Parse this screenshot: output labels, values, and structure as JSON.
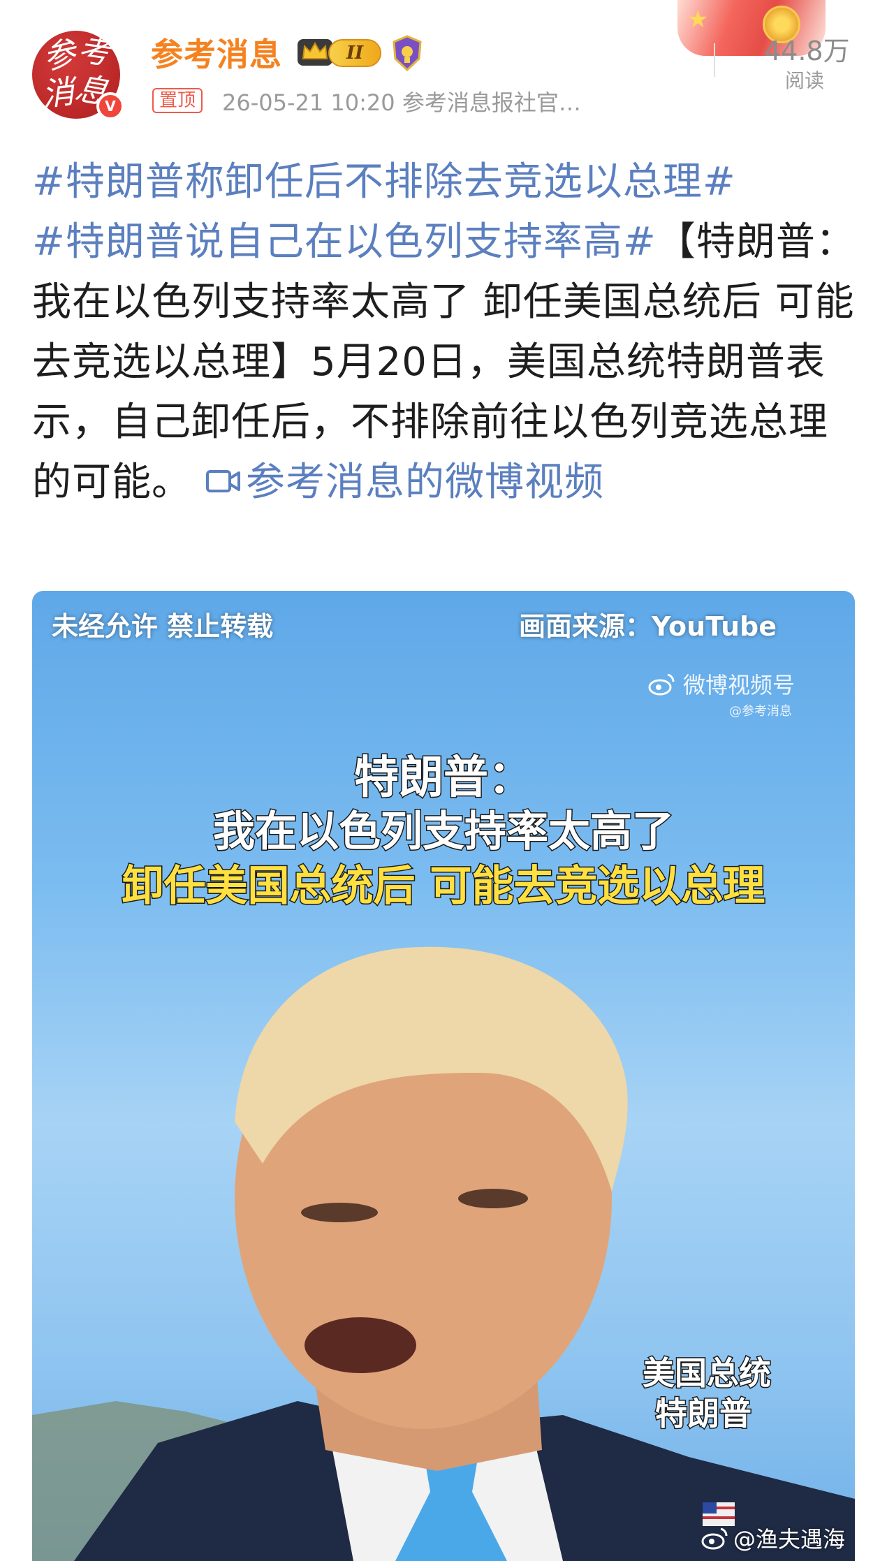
{
  "account": {
    "avatar_glyphs": [
      "参",
      "考",
      "消",
      "息"
    ],
    "verified_mark": "V",
    "name": "参考消息",
    "level_badge": "II",
    "colors": {
      "name": "#f5821f",
      "tag": "#5b7fbf",
      "pinned": "#f05a4a"
    }
  },
  "post_meta": {
    "pinned_label": "置顶",
    "info": "26-05-21 10:20  参考消息报社官…",
    "reads_count": "44.8万",
    "reads_label": "阅读"
  },
  "post": {
    "tag1": "#特朗普称卸任后不排除去竞选以总理#",
    "tag2": "#特朗普说自己在以色列支持率高#",
    "body": "【特朗普：我在以色列支持率太高了 卸任美国总统后 可能去竞选以总理】5月20日，美国总统特朗普表示，自己卸任后，不排除前往以色列竞选总理的可能。",
    "video_link": "参考消息的微博视频",
    "video_link_icon": "video-icon"
  },
  "video": {
    "top_left": "未经允许 禁止转载",
    "top_right": "画面来源：YouTube",
    "watermark": "微博视频号",
    "watermark_sub": "@参考消息",
    "caption_line1": "特朗普：",
    "caption_line2": "我在以色列支持率太高了",
    "caption_line3": "卸任美国总统后 可能去竞选以总理",
    "nameplate_line1": "美国总统",
    "nameplate_line2": "特朗普",
    "footer_watermark": "@渔夫遇海"
  }
}
